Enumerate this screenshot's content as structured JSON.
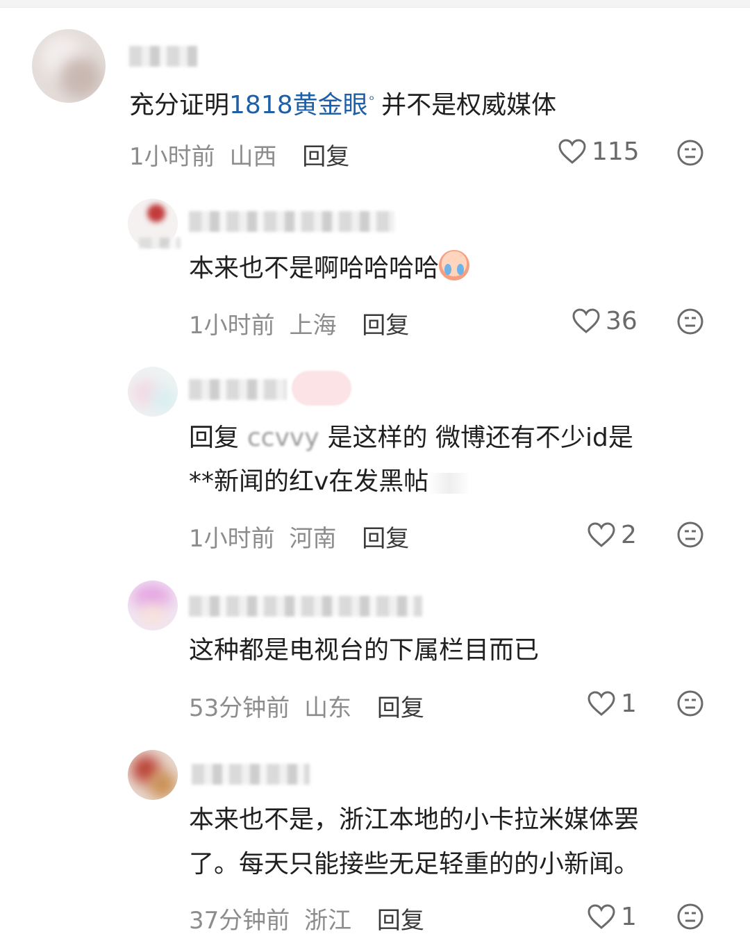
{
  "comments": [
    {
      "text_before": "充分证明",
      "link": "1818黄金眼",
      "search_glyph": "ᵒ",
      "text_after": "并不是权威媒体",
      "time": "1小时前",
      "location": "山西",
      "reply": "回复",
      "likes": "115"
    },
    {
      "text": "本来也不是啊哈哈哈哈",
      "time": "1小时前",
      "location": "上海",
      "reply": "回复",
      "likes": "36"
    },
    {
      "reply_prefix": "回复",
      "mention": "ccvvy",
      "line1": "是这样的 微博还有不少id是",
      "line2": "**新闻的红v在发黑帖",
      "time": "1小时前",
      "location": "河南",
      "reply": "回复",
      "likes": "2"
    },
    {
      "text": "这种都是电视台的下属栏目而已",
      "time": "53分钟前",
      "location": "山东",
      "reply": "回复",
      "likes": "1"
    },
    {
      "line1": "本来也不是，浙江本地的小卡拉米媒体罢",
      "line2": "了。每天只能接些无足轻重的的小新闻。",
      "time": "37分钟前",
      "location": "浙江",
      "reply": "回复",
      "likes": "1"
    }
  ],
  "icons": {
    "like": "heart-outline-icon",
    "react": "smiley-face-icon",
    "search": "search-glyph-icon",
    "emoji": "crying-laughing-emoji-icon"
  },
  "colors": {
    "link": "#1f5fa6",
    "meta": "#8c8c8c",
    "text": "#1f1f1f"
  }
}
